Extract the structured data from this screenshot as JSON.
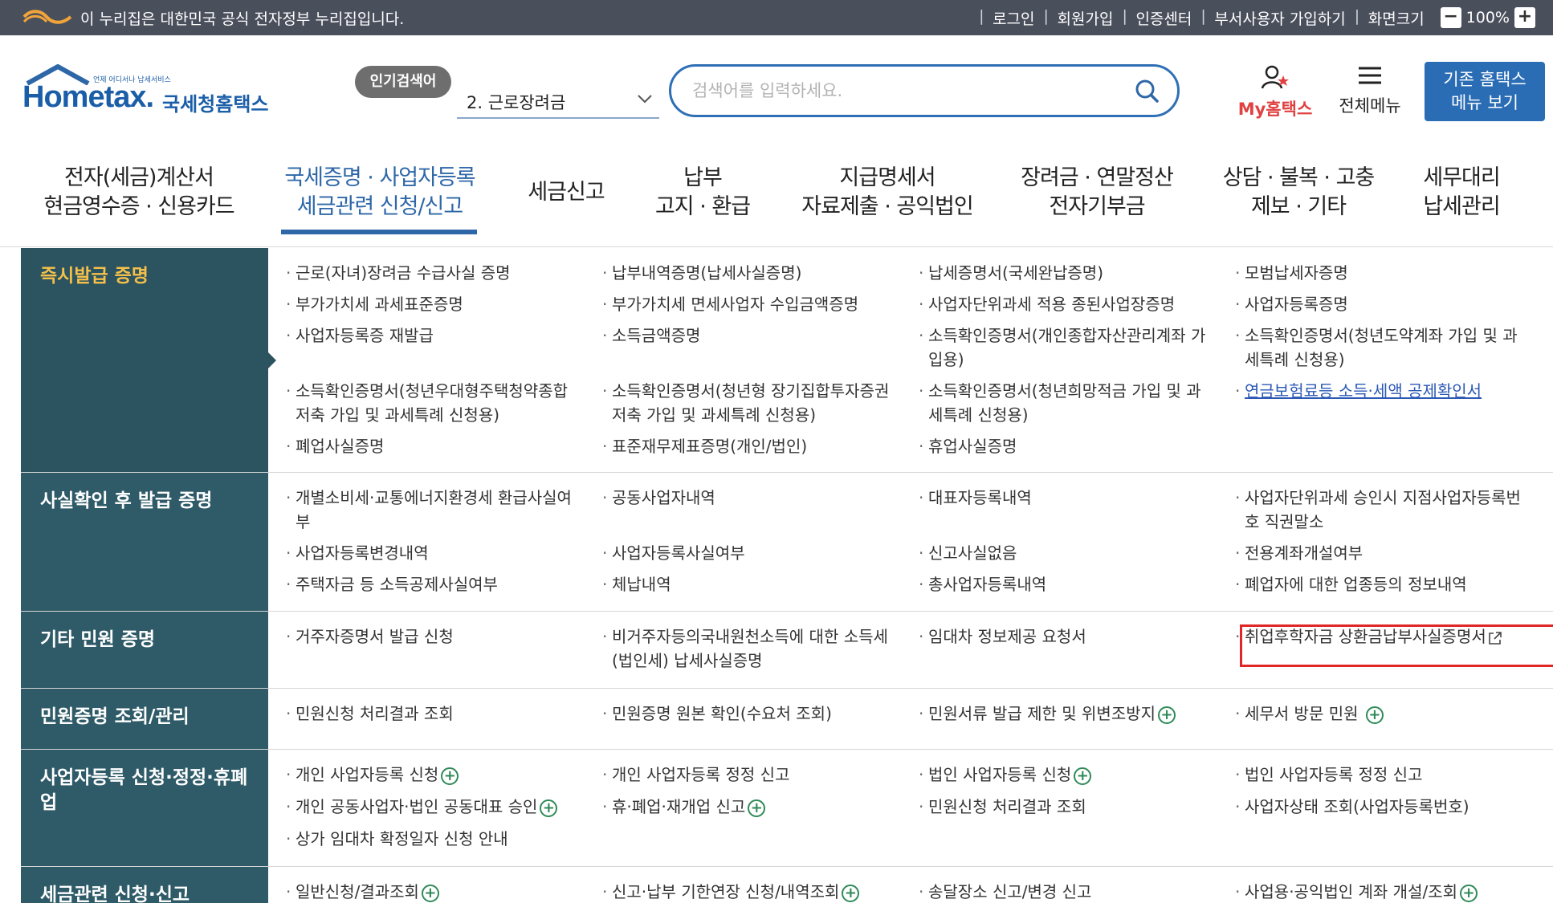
{
  "gov_bar": {
    "notice": "이 누리집은 대한민국 공식 전자정부 누리집입니다.",
    "links": [
      "로그인",
      "회원가입",
      "인증센터",
      "부서사용자 가입하기",
      "화면크기"
    ],
    "zoom_minus": "−",
    "zoom_value": "100%",
    "zoom_plus": "+"
  },
  "header": {
    "logo_home": "Home",
    "logo_tax": "tax.",
    "logo_sub": "언제 어디서나 납세서비스",
    "logo_kr": "국세청홈택스",
    "popular_badge": "인기검색어",
    "popular_selected": "2.  근로장려금",
    "search_placeholder": "검색어를 입력하세요.",
    "my_hometax": "My홈택스",
    "all_menu": "전체메뉴",
    "old_menu_line1": "기존 홈택스",
    "old_menu_line2": "메뉴 보기"
  },
  "gnb": [
    {
      "line1": "전자(세금)계산서",
      "line2": "현금영수증 · 신용카드"
    },
    {
      "line1": "국세증명 · 사업자등록",
      "line2": "세금관련 신청/신고"
    },
    {
      "line1": "세금신고",
      "line2": ""
    },
    {
      "line1": "납부",
      "line2": "고지 · 환급"
    },
    {
      "line1": "지급명세서",
      "line2": "자료제출 · 공익법인"
    },
    {
      "line1": "장려금 · 연말정산",
      "line2": "전자기부금"
    },
    {
      "line1": "상담 · 불복 · 고충",
      "line2": "제보 · 기타"
    },
    {
      "line1": "세무대리",
      "line2": "납세관리"
    }
  ],
  "sections": {
    "s1": {
      "title": "즉시발급 증명",
      "items": [
        "근로(자녀)장려금 수급사실 증명",
        "납부내역증명(납세사실증명)",
        "납세증명서(국세완납증명)",
        "모범납세자증명",
        "부가가치세 과세표준증명",
        "부가가치세 면세사업자 수입금액증명",
        "사업자단위과세 적용 종된사업장증명",
        "사업자등록증명",
        "사업자등록증 재발급",
        "소득금액증명",
        "소득확인증명서(개인종합자산관리계좌 가입용)",
        "소득확인증명서(청년도약계좌 가입 및 과세특례 신청용)",
        "소득확인증명서(청년우대형주택청약종합저축 가입 및 과세특례 신청용)",
        "소득확인증명서(청년형 장기집합투자증권저축 가입 및 과세특례 신청용)",
        "소득확인증명서(청년희망적금 가입 및 과세특례 신청용)",
        "연금보험료등 소득·세액 공제확인서",
        "폐업사실증명",
        "표준재무제표증명(개인/법인)",
        "휴업사실증명"
      ]
    },
    "s2": {
      "title": "사실확인 후 발급 증명",
      "items": [
        "개별소비세·교통에너지환경세 환급사실여부",
        "공동사업자내역",
        "대표자등록내역",
        "사업자단위과세 승인시 지점사업자등록번호 직권말소",
        "사업자등록변경내역",
        "사업자등록사실여부",
        "신고사실없음",
        "전용계좌개설여부",
        "주택자금 등 소득공제사실여부",
        "체납내역",
        "총사업자등록내역",
        "폐업자에 대한 업종등의 정보내역"
      ]
    },
    "s3": {
      "title": "기타 민원 증명",
      "items": [
        "거주자증명서 발급 신청",
        "비거주자등의국내원천소득에 대한 소득세(법인세) 납세사실증명",
        "임대차 정보제공 요청서",
        "취업후학자금 상환금납부사실증명서"
      ]
    },
    "s4": {
      "title": "민원증명 조회/관리",
      "items": [
        "민원신청 처리결과 조회",
        "민원증명 원본 확인(수요처 조회)",
        "민원서류 발급 제한 및 위변조방지",
        "세무서 방문 민원"
      ]
    },
    "s5": {
      "title": "사업자등록 신청·정정·휴폐업",
      "items": [
        "개인 사업자등록 신청",
        "개인 사업자등록 정정 신고",
        "법인 사업자등록 신청",
        "법인 사업자등록 정정 신고",
        "개인 공동사업자·법인 공동대표 승인",
        "휴·폐업·재개업 신고",
        "민원신청 처리결과 조회",
        "사업자상태 조회(사업자등록번호)",
        "상가 임대차 확정일자 신청 안내"
      ]
    },
    "s6": {
      "title": "세금관련 신청·신고",
      "items": [
        "일반신청/결과조회",
        "신고·납부 기한연장 신청/내역조회",
        "송달장소 신고/변경 신고",
        "사업용·공익법인 계좌 개설/조회"
      ]
    }
  },
  "colors": {
    "gov_bar": "#4a4f5c",
    "brand_blue": "#2e67a8",
    "category_bg": "#2f5b68",
    "category_highlight_text": "#f5c04a",
    "link_blue": "#2b59b5",
    "highlight_red": "#e02626",
    "plus_green": "#2f8a58"
  }
}
